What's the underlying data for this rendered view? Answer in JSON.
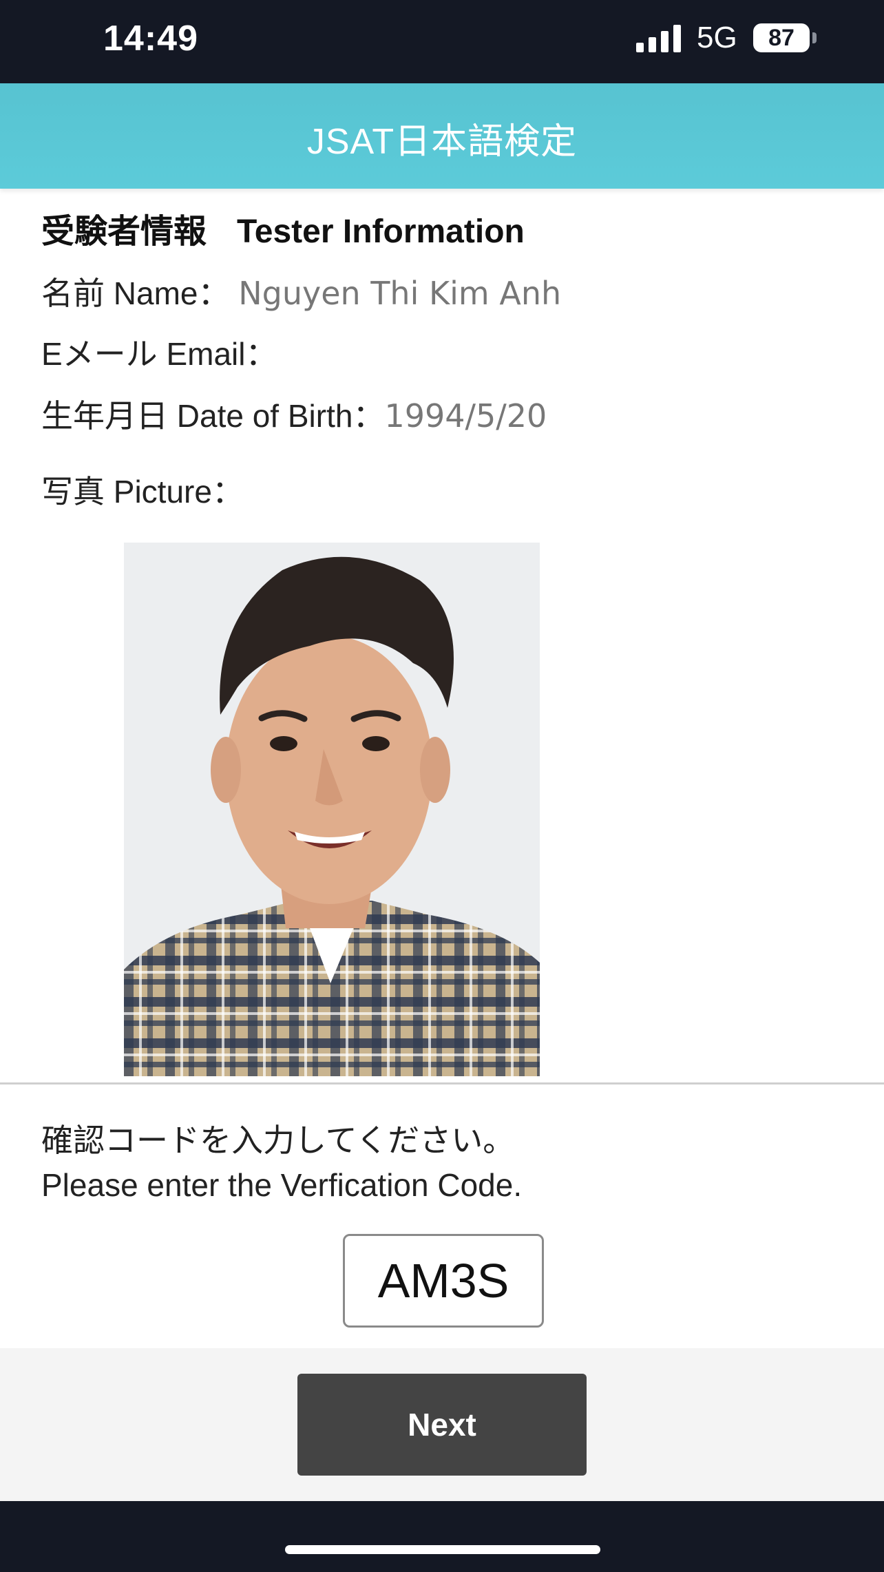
{
  "status_bar": {
    "time": "14:49",
    "network": "5G",
    "battery": "87",
    "signal_icon": "signal-bars-icon"
  },
  "header": {
    "title": "JSAT日本語検定"
  },
  "tester_info": {
    "heading_ja": "受験者情報",
    "heading_en": "Tester Information",
    "name_label": "名前 Name：",
    "name_value": "Nguyen Thi Kim Anh",
    "email_label": "Eメール Email：",
    "email_value": "",
    "dob_label": "生年月日 Date of Birth：",
    "dob_value": "1994/5/20",
    "picture_label": "写真 Picture："
  },
  "verification": {
    "prompt_ja": "確認コードを入力してください。",
    "prompt_en": "Please enter the Verfication Code.",
    "code": "AM3S"
  },
  "footer": {
    "next_label": "Next"
  },
  "colors": {
    "header_bg": "#5ccbd9",
    "status_bg": "#141824",
    "button_bg": "#444444"
  }
}
